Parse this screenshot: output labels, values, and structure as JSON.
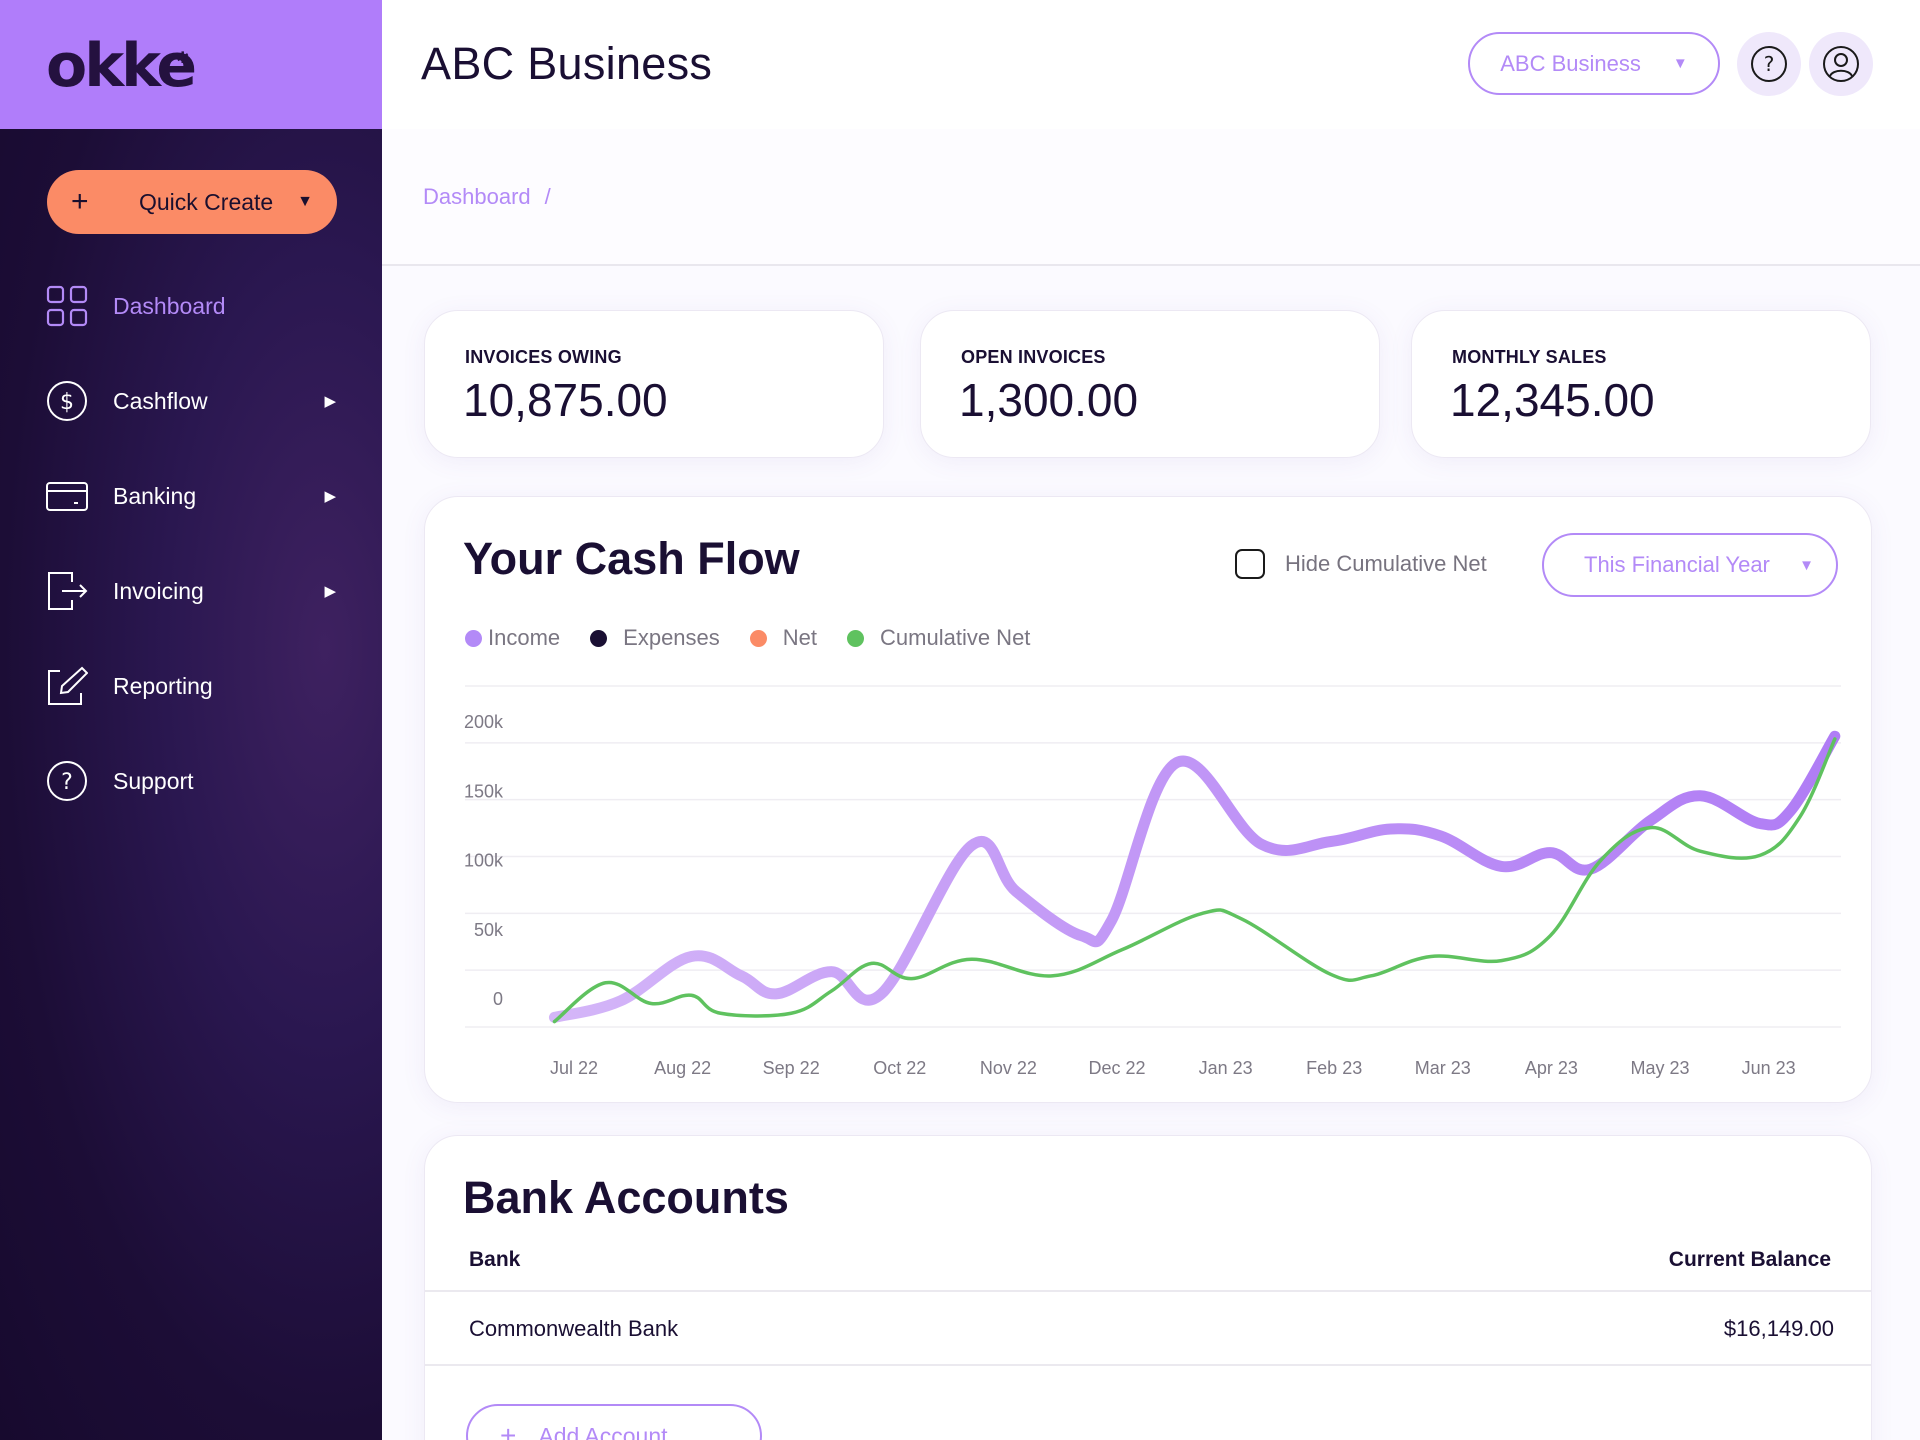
{
  "app": {
    "logo": "okke",
    "brand_color": "#b07dfa",
    "accent_color": "#b38af7",
    "cta_color": "#fb8b66"
  },
  "sidebar": {
    "quick_create": {
      "label": "Quick Create",
      "icon": "plus-icon",
      "caret": "▼"
    },
    "items": [
      {
        "label": "Dashboard",
        "icon": "grid-icon",
        "active": true,
        "has_submenu": false
      },
      {
        "label": "Cashflow",
        "icon": "dollar-circle-icon",
        "active": false,
        "has_submenu": true
      },
      {
        "label": "Banking",
        "icon": "card-icon",
        "active": false,
        "has_submenu": true
      },
      {
        "label": "Invoicing",
        "icon": "export-icon",
        "active": false,
        "has_submenu": true
      },
      {
        "label": "Reporting",
        "icon": "edit-icon",
        "active": false,
        "has_submenu": false
      },
      {
        "label": "Support",
        "icon": "help-circle-icon",
        "active": false,
        "has_submenu": false
      }
    ],
    "submenu_arrow": "▶"
  },
  "header": {
    "title": "ABC Business",
    "business_select": {
      "value": "ABC Business",
      "caret": "▼"
    },
    "help_icon": "help-icon",
    "user_icon": "user-icon"
  },
  "breadcrumb": {
    "items": [
      "Dashboard"
    ],
    "separator": "/"
  },
  "stats": [
    {
      "label": "INVOICES OWING",
      "value": "10,875.00"
    },
    {
      "label": "OPEN INVOICES",
      "value": "1,300.00"
    },
    {
      "label": "MONTHLY SALES",
      "value": "12,345.00"
    }
  ],
  "cashflow": {
    "title": "Your Cash Flow",
    "hide_cumulative": {
      "label": "Hide Cumulative Net",
      "checked": false
    },
    "range_select": {
      "value": "This Financial Year",
      "caret": "▼"
    }
  },
  "chart_data": {
    "type": "line",
    "title": "Your Cash Flow",
    "xlabel": "",
    "ylabel": "",
    "categories": [
      "Jul 22",
      "Aug 22",
      "Sep 22",
      "Oct 22",
      "Nov 22",
      "Dec 22",
      "Jan 23",
      "Feb 23",
      "Mar 23",
      "Apr 23",
      "May 23",
      "Jun 23"
    ],
    "yticks": [
      "200k",
      "150k",
      "100k",
      "50k",
      "0"
    ],
    "ytick_values": [
      200000,
      150000,
      100000,
      50000,
      0
    ],
    "ylim": [
      -25000,
      210000
    ],
    "grid": true,
    "legend_position": "top-left",
    "legend": [
      {
        "name": "Income",
        "color": "#b38af7"
      },
      {
        "name": "Expenses",
        "color": "#1a0f33"
      },
      {
        "name": "Net",
        "color": "#fb8b66"
      },
      {
        "name": "Cumulative Net",
        "color": "#5fc25f"
      }
    ],
    "series": [
      {
        "name": "Income",
        "color": "#b38af7",
        "x_month_index": [
          -0.18,
          0.43,
          1.08,
          1.54,
          1.86,
          2.37,
          2.83,
          3.66,
          4.07,
          4.67,
          4.95,
          5.55,
          6.33,
          6.97,
          7.52,
          7.98,
          8.54,
          8.99,
          9.36,
          9.91,
          10.37,
          10.92,
          11.2,
          11.61
        ],
        "values": [
          -14000,
          -2000,
          30000,
          16000,
          3000,
          19000,
          3000,
          110000,
          77000,
          45000,
          56000,
          170000,
          111000,
          113000,
          122000,
          117000,
          95000,
          105000,
          93000,
          128000,
          146000,
          126000,
          135000,
          189000
        ]
      },
      {
        "name": "Cumulative Net",
        "color": "#5fc25f",
        "x_month_index": [
          -0.18,
          0.29,
          0.71,
          1.08,
          1.35,
          2.0,
          2.37,
          2.74,
          3.11,
          3.66,
          4.4,
          5.05,
          5.78,
          6.15,
          6.97,
          7.34,
          7.89,
          8.54,
          8.99,
          9.45,
          9.91,
          10.37,
          10.92,
          11.29,
          11.61
        ],
        "values": [
          -17000,
          11000,
          -4000,
          2000,
          -11000,
          -11000,
          5000,
          25000,
          14000,
          28000,
          16000,
          35000,
          61000,
          57000,
          17000,
          16000,
          30000,
          27000,
          45000,
          99000,
          123000,
          106000,
          103000,
          131000,
          187000
        ]
      }
    ]
  },
  "bank_accounts": {
    "title": "Bank Accounts",
    "columns": [
      "Bank",
      "Current Balance"
    ],
    "rows": [
      {
        "bank": "Commonwealth Bank",
        "balance": "$16,149.00"
      }
    ],
    "add_button": "Add Account"
  }
}
